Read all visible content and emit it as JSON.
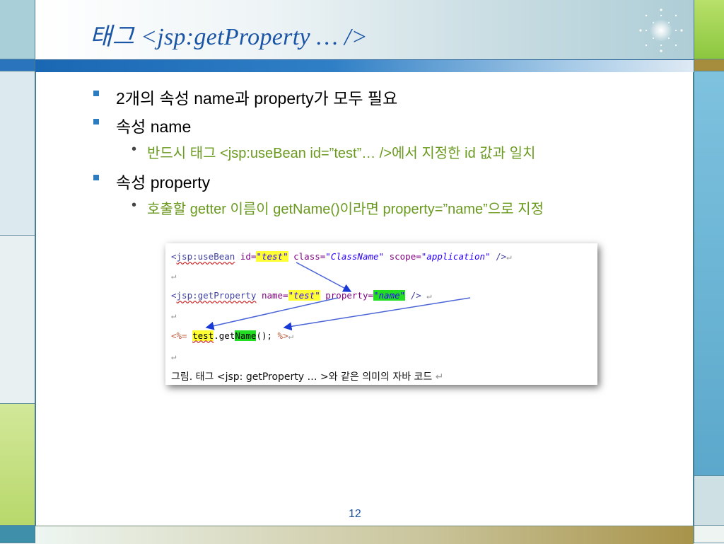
{
  "slide": {
    "title": "태그 <jsp:getProperty … />",
    "page_number": "12"
  },
  "bullets": [
    {
      "text": "2개의 속성 name과 property가 모두 필요"
    },
    {
      "text": "속성 name"
    },
    {
      "text": "반드시 태그 <jsp:useBean id=”test”… />에서 지정한 id 값과 일치"
    },
    {
      "text": "속성 property"
    },
    {
      "text": "호출할 getter 이름이 getName()이라면 property=”name”으로 지정"
    }
  ],
  "code_figure": {
    "line1": {
      "open": "<",
      "tag": "jsp:useBean",
      "id_attr": " id=",
      "id_val": "\"test\"",
      "class_attr": " class=",
      "class_val": "\"ClassName\"",
      "scope_attr": " scope=",
      "scope_val": "\"application\"",
      "close": " />"
    },
    "line3": {
      "open": "<",
      "tag": "jsp:getProperty",
      "name_attr": " name=",
      "name_val": "\"test\"",
      "prop_attr": " property=",
      "prop_val": "\"name\"",
      "close": " />"
    },
    "line5": {
      "open": "<%= ",
      "obj": "test",
      "mid": ".get",
      "method": "Name",
      "rest": "(); ",
      "close": "%>"
    },
    "return_mark": "↵",
    "caption": "그림. 태그 <jsp: getProperty … >와 같은 의미의 자바 코드"
  },
  "colors": {
    "accent_blue": "#1a55a6",
    "bullet_square": "#2c7cc0",
    "sub_bullet_green": "#6a9a1f",
    "highlight_yellow": "#ffff33",
    "highlight_green": "#22dd22"
  }
}
